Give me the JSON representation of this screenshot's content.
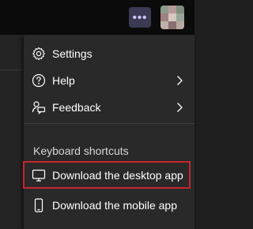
{
  "header": {
    "more_label": "•••"
  },
  "menu": {
    "items": [
      {
        "label": "Settings",
        "icon": "gear-icon"
      },
      {
        "label": "Help",
        "icon": "help-circle-icon",
        "has_submenu": true
      },
      {
        "label": "Feedback",
        "icon": "feedback-icon",
        "has_submenu": true
      }
    ],
    "section_label": "Keyboard shortcuts",
    "downloads": [
      {
        "label": "Download the desktop app",
        "icon": "desktop-monitor-icon",
        "highlighted": true
      },
      {
        "label": "Download the mobile app",
        "icon": "mobile-phone-icon"
      }
    ]
  },
  "colors": {
    "highlight_border": "#c4262e",
    "menu_bg": "#292929",
    "more_button_bg": "#3a3a55"
  }
}
